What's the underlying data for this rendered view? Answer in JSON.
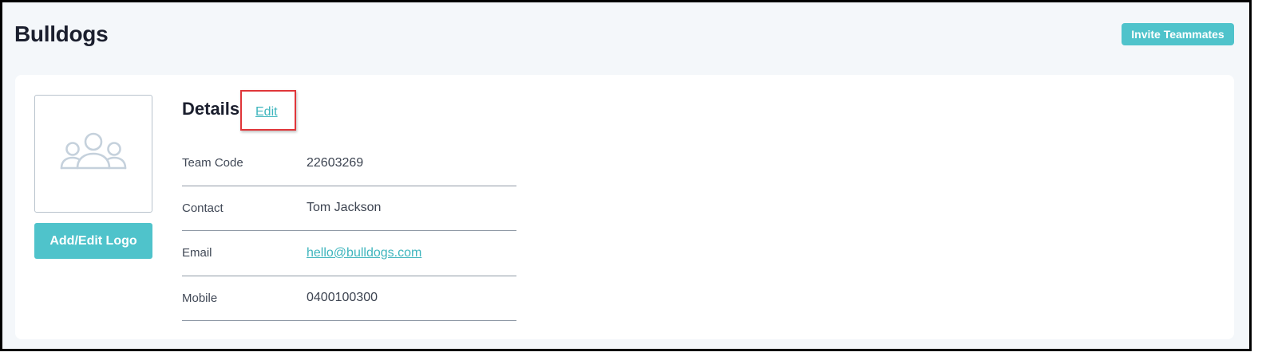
{
  "header": {
    "title": "Bulldogs",
    "invite_label": "Invite Teammates"
  },
  "logo": {
    "placeholder_icon": "team-group-icon",
    "button_label": "Add/Edit Logo"
  },
  "details": {
    "heading": "Details",
    "edit_label": "Edit",
    "rows": [
      {
        "label": "Team Code",
        "value": "22603269"
      },
      {
        "label": "Contact",
        "value": "Tom Jackson"
      },
      {
        "label": "Email",
        "value": "hello@bulldogs.com"
      },
      {
        "label": "Mobile",
        "value": "0400100300"
      }
    ]
  },
  "colors": {
    "accent": "#4fc3cb",
    "link": "#3eb5bd",
    "highlight": "#e0363a",
    "background": "#f4f7fa"
  }
}
